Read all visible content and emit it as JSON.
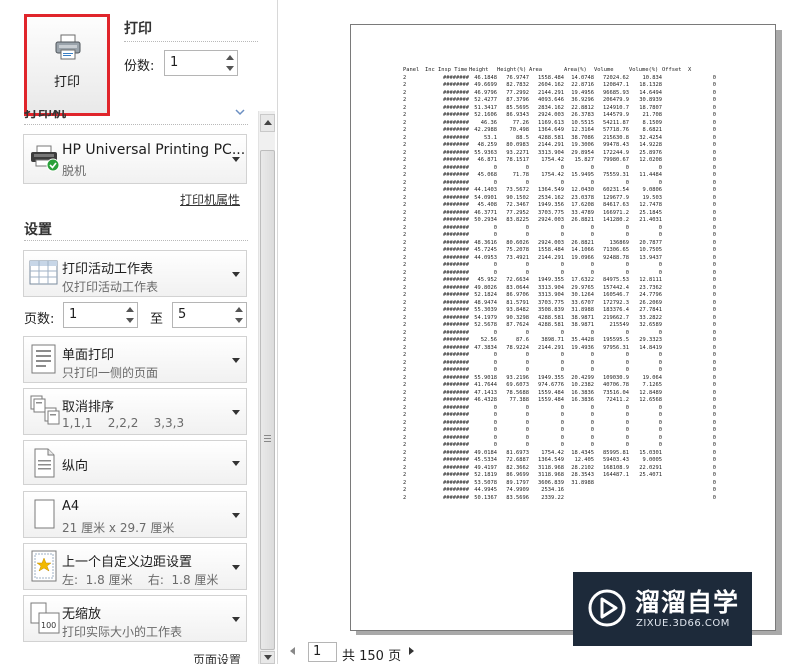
{
  "print_button": {
    "label": "打印"
  },
  "print_section": {
    "title": "打印",
    "copies_label": "份数:",
    "copies_value": "1"
  },
  "printer": {
    "heading": "打印机",
    "name": "HP Universal Printing PC...",
    "status": "脱机",
    "properties_link": "打印机属性"
  },
  "settings": {
    "heading": "设置",
    "what_to_print": {
      "title": "打印活动工作表",
      "subtitle": "仅打印活动工作表"
    },
    "pages": {
      "label": "页数:",
      "from": "1",
      "to_label": "至",
      "to": "5"
    },
    "sides": {
      "title": "单面打印",
      "subtitle": "只打印一侧的页面"
    },
    "collation": {
      "title": "取消排序",
      "subtitle": "1,1,1    2,2,2    3,3,3"
    },
    "orientation": {
      "title": "纵向"
    },
    "paper": {
      "title": "A4",
      "subtitle": "21 厘米 x 29.7 厘米"
    },
    "margins": {
      "title": "上一个自定义边距设置",
      "subtitle": "左:  1.8 厘米    右:  1.8 厘米"
    },
    "scaling": {
      "title": "无缩放",
      "subtitle": "打印实际大小的工作表"
    },
    "page_setup_link": "页面设置"
  },
  "preview": {
    "headers": [
      "Panel",
      "Inc Insp Time",
      "Height",
      "Height(%)",
      "Area",
      "Area(%)",
      "Volume",
      "Volume(%)",
      "Offset",
      "X"
    ],
    "rows": [
      [
        "2",
        "########",
        "46.1848",
        "76.9747",
        "1558.484",
        "14.0748",
        "72024.62",
        "10.834",
        "",
        "0"
      ],
      [
        "2",
        "########",
        "49.6699",
        "82.7832",
        "2604.162",
        "22.8716",
        "120847.1",
        "18.1328",
        "",
        "0"
      ],
      [
        "2",
        "########",
        "46.9796",
        "77.2992",
        "2144.291",
        "19.4956",
        "96685.93",
        "14.6494",
        "",
        "0"
      ],
      [
        "2",
        "########",
        "52.4277",
        "87.3796",
        "4093.646",
        "36.9296",
        "206479.9",
        "30.8939",
        "",
        "0"
      ],
      [
        "2",
        "########",
        "51.3417",
        "85.5695",
        "2834.162",
        "22.8812",
        "124910.7",
        "18.7807",
        "",
        "0"
      ],
      [
        "2",
        "########",
        "52.1606",
        "86.9343",
        "2924.003",
        "26.3783",
        "144579.9",
        "21.708",
        "",
        "0"
      ],
      [
        "2",
        "########",
        "46.36",
        "77.26",
        "1169.613",
        "10.5515",
        "54211.87",
        "8.1509",
        "",
        "0"
      ],
      [
        "2",
        "########",
        "42.2988",
        "70.498",
        "1364.649",
        "12.3164",
        "57718.76",
        "8.6821",
        "",
        "0"
      ],
      [
        "2",
        "########",
        "53.1",
        "88.5",
        "4288.581",
        "38.7086",
        "215630.8",
        "32.4254",
        "",
        "0"
      ],
      [
        "2",
        "########",
        "48.259",
        "80.0983",
        "2144.291",
        "19.3006",
        "99478.43",
        "14.9228",
        "",
        "0"
      ],
      [
        "2",
        "########",
        "55.9363",
        "93.2271",
        "3313.904",
        "29.8954",
        "172244.9",
        "25.8976",
        "",
        "0"
      ],
      [
        "2",
        "########",
        "46.871",
        "78.1517",
        "1754.42",
        "15.827",
        "79980.67",
        "12.0208",
        "",
        "0"
      ],
      [
        "2",
        "########",
        "0",
        "0",
        "0",
        "0",
        "0",
        "0",
        "",
        "0"
      ],
      [
        "2",
        "########",
        "45.068",
        "71.78",
        "1754.42",
        "15.9495",
        "75559.31",
        "11.4484",
        "",
        "0"
      ],
      [
        "2",
        "########",
        "0",
        "0",
        "0",
        "0",
        "0",
        "0",
        "",
        "0"
      ],
      [
        "2",
        "########",
        "44.1403",
        "73.5672",
        "1364.549",
        "12.0430",
        "60231.54",
        "9.0806",
        "",
        "0"
      ],
      [
        "2",
        "########",
        "54.0901",
        "90.1502",
        "2534.162",
        "23.0378",
        "129677.9",
        "19.503",
        "",
        "0"
      ],
      [
        "2",
        "########",
        "45.408",
        "72.3467",
        "1949.356",
        "17.6208",
        "84617.63",
        "12.7478",
        "",
        "0"
      ],
      [
        "2",
        "########",
        "46.3771",
        "77.2952",
        "3703.775",
        "33.4789",
        "166971.2",
        "25.1845",
        "",
        "0"
      ],
      [
        "2",
        "########",
        "50.2934",
        "83.8225",
        "2924.003",
        "26.8821",
        "141280.2",
        "21.4031",
        "",
        "0"
      ],
      [
        "2",
        "########",
        "0",
        "0",
        "0",
        "0",
        "0",
        "0",
        "",
        "0"
      ],
      [
        "2",
        "########",
        "0",
        "0",
        "0",
        "0",
        "0",
        "0",
        "",
        "0"
      ],
      [
        "2",
        "########",
        "48.3616",
        "80.6026",
        "2924.003",
        "26.8821",
        "136869",
        "20.7877",
        "",
        "0"
      ],
      [
        "2",
        "########",
        "45.7245",
        "75.2078",
        "1558.484",
        "14.1066",
        "71306.65",
        "10.7505",
        "",
        "0"
      ],
      [
        "2",
        "########",
        "44.0953",
        "73.4921",
        "2144.291",
        "19.0966",
        "92488.78",
        "13.9437",
        "",
        "0"
      ],
      [
        "2",
        "########",
        "0",
        "0",
        "0",
        "0",
        "0",
        "0",
        "",
        "0"
      ],
      [
        "2",
        "########",
        "0",
        "0",
        "0",
        "0",
        "0",
        "0",
        "",
        "0"
      ],
      [
        "2",
        "########",
        "45.952",
        "72.6634",
        "1949.355",
        "17.6322",
        "84975.53",
        "12.8111",
        "",
        "0"
      ],
      [
        "2",
        "########",
        "49.8026",
        "83.0644",
        "3313.904",
        "29.9765",
        "157442.4",
        "23.7362",
        "",
        "0"
      ],
      [
        "2",
        "########",
        "52.1824",
        "86.9706",
        "3313.904",
        "30.1264",
        "160546.7",
        "24.7796",
        "",
        "0"
      ],
      [
        "2",
        "########",
        "48.9474",
        "81.5791",
        "3703.775",
        "33.6707",
        "172792.3",
        "26.2069",
        "",
        "0"
      ],
      [
        "2",
        "########",
        "55.3039",
        "93.8482",
        "3508.839",
        "31.8988",
        "183376.4",
        "27.7841",
        "",
        "0"
      ],
      [
        "2",
        "########",
        "54.1979",
        "90.3298",
        "4288.581",
        "38.9871",
        "219662.7",
        "33.2822",
        "",
        "0"
      ],
      [
        "2",
        "########",
        "52.5678",
        "87.7624",
        "4288.581",
        "38.9871",
        "215549",
        "32.6589",
        "",
        "0"
      ],
      [
        "2",
        "########",
        "0",
        "0",
        "0",
        "0",
        "0",
        "0",
        "",
        "0"
      ],
      [
        "2",
        "########",
        "52.56",
        "87.6",
        "3898.71",
        "35.4428",
        "195595.5",
        "29.3323",
        "",
        "0"
      ],
      [
        "2",
        "########",
        "47.3834",
        "78.9224",
        "2144.291",
        "19.4936",
        "97956.31",
        "14.8419",
        "",
        "0"
      ],
      [
        "2",
        "########",
        "0",
        "0",
        "0",
        "0",
        "0",
        "0",
        "",
        "0"
      ],
      [
        "2",
        "########",
        "0",
        "0",
        "0",
        "0",
        "0",
        "0",
        "",
        "0"
      ],
      [
        "2",
        "########",
        "0",
        "0",
        "0",
        "0",
        "0",
        "0",
        "",
        "0"
      ],
      [
        "2",
        "########",
        "55.9018",
        "93.2196",
        "1949.355",
        "20.4299",
        "109030.9",
        "19.064",
        "",
        "0"
      ],
      [
        "2",
        "########",
        "41.7644",
        "69.6073",
        "974.6776",
        "10.2382",
        "40706.78",
        "7.1265",
        "",
        "0"
      ],
      [
        "2",
        "########",
        "47.1413",
        "78.5688",
        "1559.484",
        "16.3836",
        "73516.04",
        "12.8489",
        "",
        "0"
      ],
      [
        "2",
        "########",
        "46.4328",
        "77.388",
        "1559.484",
        "16.3836",
        "72411.2",
        "12.6568",
        "",
        "0"
      ],
      [
        "2",
        "########",
        "0",
        "0",
        "0",
        "0",
        "0",
        "0",
        "",
        "0"
      ],
      [
        "2",
        "########",
        "0",
        "0",
        "0",
        "0",
        "0",
        "0",
        "",
        "0"
      ],
      [
        "2",
        "########",
        "0",
        "0",
        "0",
        "0",
        "0",
        "0",
        "",
        "0"
      ],
      [
        "2",
        "########",
        "0",
        "0",
        "0",
        "0",
        "0",
        "0",
        "",
        "0"
      ],
      [
        "2",
        "########",
        "0",
        "0",
        "0",
        "0",
        "0",
        "0",
        "",
        "0"
      ],
      [
        "2",
        "########",
        "0",
        "0",
        "0",
        "0",
        "0",
        "0",
        "",
        "0"
      ],
      [
        "2",
        "########",
        "49.0184",
        "81.6973",
        "1754.42",
        "18.4345",
        "85995.81",
        "15.0301",
        "",
        "0"
      ],
      [
        "2",
        "########",
        "45.5334",
        "72.6887",
        "1364.549",
        "12.405",
        "59403.43",
        "9.0005",
        "",
        "0"
      ],
      [
        "2",
        "########",
        "49.4197",
        "82.3662",
        "3118.968",
        "28.2102",
        "168108.9",
        "22.0291",
        "",
        "0"
      ],
      [
        "2",
        "########",
        "52.1819",
        "86.9699",
        "3118.968",
        "28.3543",
        "164487.1",
        "25.4071",
        "",
        "0"
      ],
      [
        "2",
        "########",
        "53.5078",
        "89.1797",
        "3606.839",
        "31.8988",
        "",
        "",
        "",
        "0"
      ],
      [
        "2",
        "########",
        "44.9945",
        "74.9909",
        "2534.16",
        "",
        "",
        "",
        "",
        "0"
      ],
      [
        "2",
        "########",
        "50.1367",
        "83.5696",
        "2339.22",
        "",
        "",
        "",
        "",
        "0"
      ]
    ]
  },
  "page_nav": {
    "current": "1",
    "total": "共 150 页"
  },
  "watermark": {
    "title": "溜溜自学",
    "subtitle": "ZIXUE.3D66.COM"
  }
}
